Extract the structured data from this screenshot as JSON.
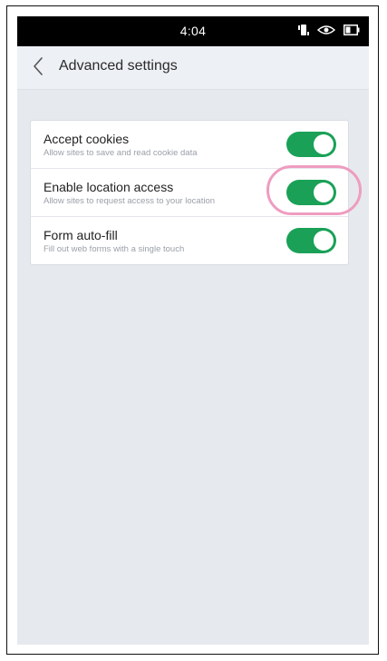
{
  "status_bar": {
    "time": "4:04",
    "icons": [
      "vibrate-icon",
      "eye-icon",
      "battery-icon"
    ]
  },
  "header": {
    "back_icon": "chevron-left-icon",
    "title": "Advanced settings"
  },
  "settings": [
    {
      "title": "Accept cookies",
      "description": "Allow sites to save and read cookie data",
      "enabled": true
    },
    {
      "title": "Enable location access",
      "description": "Allow sites to request access to your location",
      "enabled": true
    },
    {
      "title": "Form auto-fill",
      "description": "Fill out web forms with a single touch",
      "enabled": true
    }
  ],
  "colors": {
    "toggle_on": "#1aa157",
    "highlight": "#ef9cc0",
    "background": "#e6e9ee"
  }
}
